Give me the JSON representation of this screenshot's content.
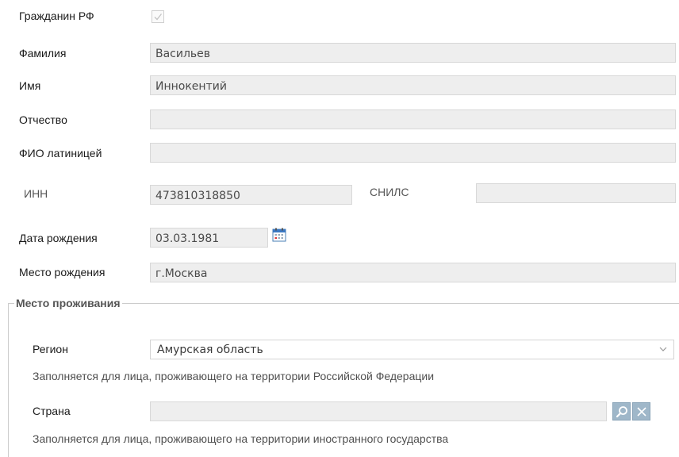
{
  "form": {
    "citizen_label": "Гражданин РФ",
    "citizen_checked": true,
    "surname_label": "Фамилия",
    "surname_value": "Васильев",
    "name_label": "Имя",
    "name_value": "Иннокентий",
    "patronymic_label": "Отчество",
    "patronymic_value": "",
    "latin_label": "ФИО латиницей",
    "latin_value": "",
    "inn_label": "ИНН",
    "inn_value": "473810318850",
    "snils_label": "СНИЛС",
    "snils_value": "",
    "birthdate_label": "Дата рождения",
    "birthdate_value": "03.03.1981",
    "birthplace_label": "Место рождения",
    "birthplace_value": "г.Москва"
  },
  "residence": {
    "legend": "Место проживания",
    "region_label": "Регион",
    "region_value": "Амурская область",
    "region_hint": "Заполняется для лица, проживающего на территории Российской Федерации",
    "country_label": "Страна",
    "country_value": "",
    "country_hint": "Заполняется для лица, проживающего на территории иностранного государства"
  },
  "icons": {
    "checkbox": "check-icon",
    "calendar": "calendar-icon",
    "region_dropdown": "chevron-down-icon",
    "country_search": "search-icon",
    "country_clear": "close-icon"
  },
  "colors": {
    "field_bg": "#eeeeee",
    "button_bg": "#9fb7c9",
    "legend_text": "#555555"
  }
}
